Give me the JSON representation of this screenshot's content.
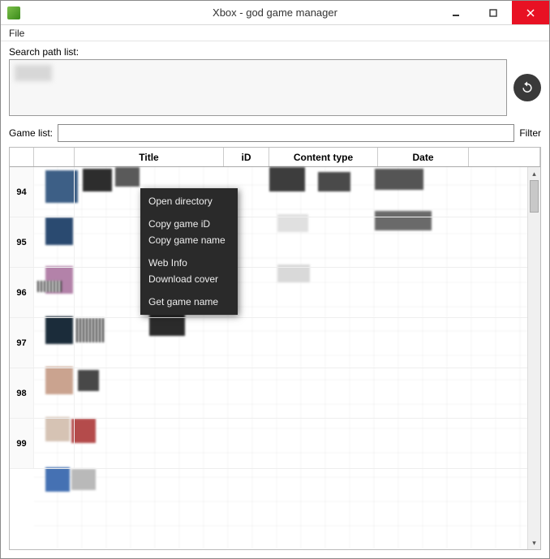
{
  "titlebar": {
    "title": "Xbox - god game manager"
  },
  "menu": {
    "file": "File"
  },
  "search": {
    "label": "Search path list:"
  },
  "gamelist": {
    "label": "Game list:",
    "filter_label": "Filter",
    "filter_value": ""
  },
  "columns": {
    "title": "Title",
    "id": "iD",
    "content_type": "Content type",
    "date": "Date"
  },
  "rows": [
    {
      "num": "94"
    },
    {
      "num": "95"
    },
    {
      "num": "96"
    },
    {
      "num": "97"
    },
    {
      "num": "98"
    },
    {
      "num": "99"
    }
  ],
  "context_menu": {
    "open_directory": "Open directory",
    "copy_game_id": "Copy game iD",
    "copy_game_name": "Copy game name",
    "web_info": "Web Info",
    "download_cover": "Download cover",
    "get_game_name": "Get game name"
  }
}
